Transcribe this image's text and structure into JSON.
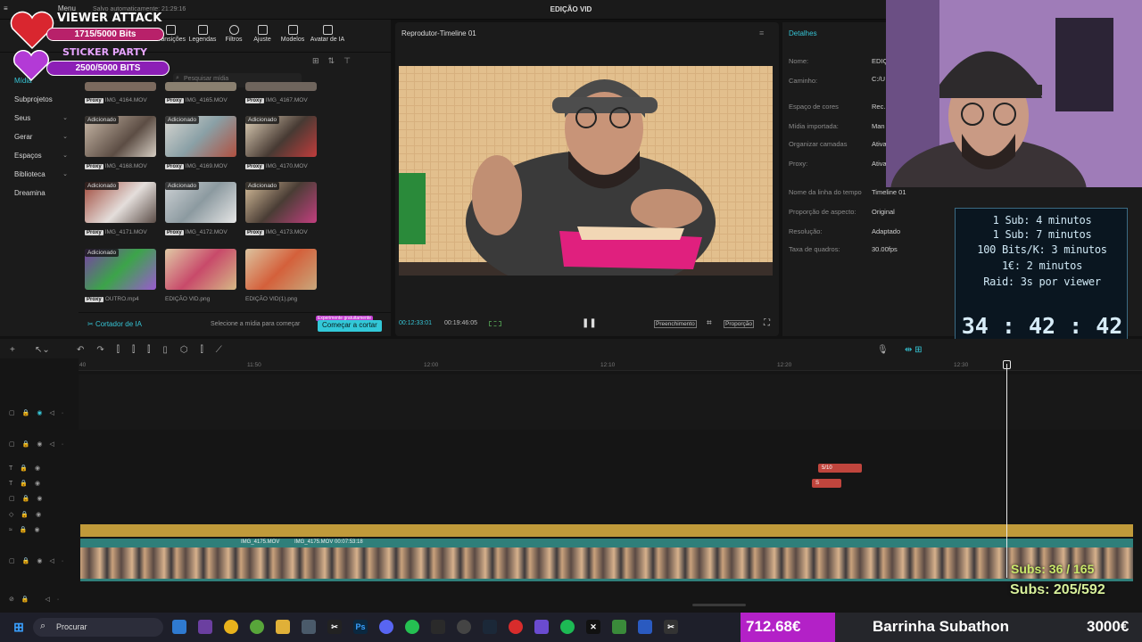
{
  "app": {
    "title": "EDIÇÃO VID",
    "autosave": "Salvo automaticamente: 21:29:16",
    "menu_label": "Menu"
  },
  "toolbar": {
    "items": [
      "Transições",
      "Legendas",
      "Filtros",
      "Ajuste",
      "Modelos",
      "Avatar de IA"
    ]
  },
  "media": {
    "search_placeholder": "Pesquisar mídia",
    "nav": [
      {
        "label": "Mídia"
      },
      {
        "label": "Subprojetos"
      },
      {
        "label": "Seus"
      },
      {
        "label": "Gerar"
      },
      {
        "label": "Espaços"
      },
      {
        "label": "Biblioteca"
      },
      {
        "label": "Dreamina"
      }
    ],
    "badge": "Adicionado",
    "proxy": "Proxy",
    "rows": [
      [
        "IMG_4164.MOV",
        "IMG_4165.MOV",
        "IMG_4167.MOV"
      ],
      [
        "IMG_4168.MOV",
        "IMG_4169.MOV",
        "IMG_4170.MOV"
      ],
      [
        "IMG_4171.MOV",
        "IMG_4172.MOV",
        "IMG_4173.MOV"
      ],
      [
        "OUTRO.mp4",
        "EDIÇÃO VID.png",
        "EDIÇÃO VID(1).png"
      ]
    ]
  },
  "ai_cutter": {
    "label": "Cortador de IA",
    "hint": "Selecione a mídia para começar",
    "trial": "Experimente gratuitamente",
    "button": "Começar a cortar"
  },
  "player": {
    "title": "Reprodutor-Timeline 01",
    "current_time": "00:12:33:01",
    "total_time": "00:19:46:05",
    "fill_label": "Preenchimento",
    "ratio_label": "Proporção"
  },
  "details": {
    "tab": "Detalhes",
    "rows": [
      {
        "label": "Nome:",
        "value": "EDIÇ"
      },
      {
        "label": "Caminho:",
        "value": "C:/U"
      },
      {
        "label": "Espaço de cores",
        "value": "Rec."
      },
      {
        "label": "Mídia importada:",
        "value": "Man"
      },
      {
        "label": "Organizar camadas",
        "value": "Ativa"
      },
      {
        "label": "Proxy:",
        "value": "Ativa"
      },
      {
        "label": "Nome da linha do tempo",
        "value": "Timeline 01"
      },
      {
        "label": "Proporção de aspecto:",
        "value": "Original"
      },
      {
        "label": "Resolução:",
        "value": "Adaptado"
      },
      {
        "label": "Taxa de quadros:",
        "value": "30.00fps"
      }
    ]
  },
  "timeline": {
    "ruler": [
      "40",
      "11:50",
      "12:00",
      "12:10",
      "12:20",
      "12:30"
    ],
    "clip1_name": "IMG_4175.MOV",
    "clip2_name": "IMG_4175.MOV",
    "clip2_dur": "00:07:53:18",
    "red1": "5/10",
    "red2": "S"
  },
  "overlay": {
    "viewer_attack": "VIEWER ATTACK",
    "bits1": "1715/5000 Bits",
    "sticker_party": "STICKER PARTY",
    "bits2": "2500/5000 BITS",
    "timer_lines": [
      "1 Sub: 4 minutos",
      "1 Sub: 7 minutos",
      "100 Bits/K: 3 minutos",
      "1€: 2 minutos",
      "Raid: 3s por viewer"
    ],
    "clock": "34 : 42 : 42",
    "subs1": "Subs: 36 / 165",
    "subs2": "Subs: 205/592",
    "money": "712.68€",
    "bar_title": "Barrinha Subathon",
    "goal": "3000€"
  },
  "taskbar": {
    "search": "Procurar"
  }
}
